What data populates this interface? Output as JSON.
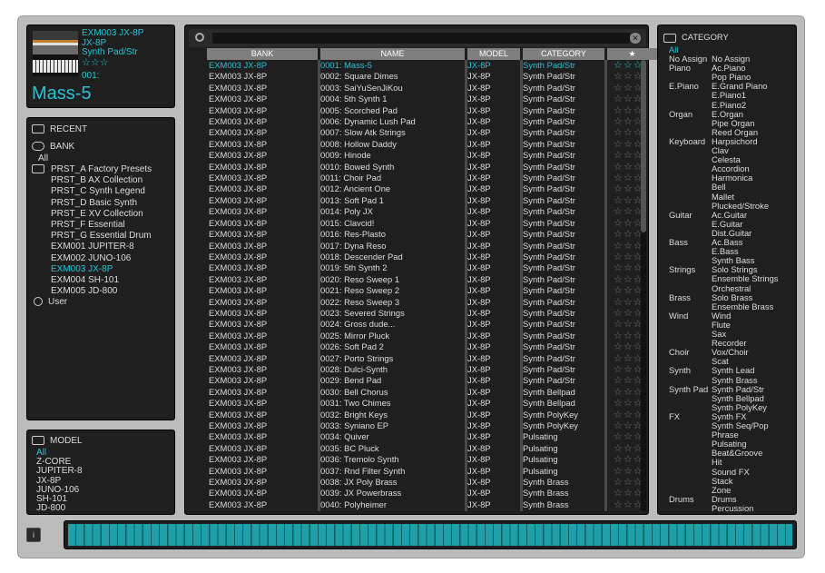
{
  "info": {
    "line1": "EXM003 JX-8P",
    "line2": "JX-8P",
    "line3": "Synth Pad/Str",
    "stars": "☆☆☆",
    "number": "001:",
    "patch": "Mass-5"
  },
  "nav": {
    "recent": "RECENT",
    "bank": "BANK",
    "all": "All",
    "user": "User",
    "banks": [
      "PRST_A Factory Presets",
      "PRST_B AX Collection",
      "PRST_C Synth Legend",
      "PRST_D Basic Synth",
      "PRST_E XV Collection",
      "PRST_F Essential",
      "PRST_G Essential Drum",
      "EXM001 JUPITER-8",
      "EXM002 JUNO-106",
      "EXM003 JX-8P",
      "EXM004 SH-101",
      "EXM005 JD-800"
    ]
  },
  "model": {
    "title": "MODEL",
    "items": [
      "All",
      "Z-CORE",
      "JUPITER-8",
      "JX-8P",
      "JUNO-106",
      "SH-101",
      "JD-800"
    ]
  },
  "list": {
    "headers": [
      "BANK",
      "NAME",
      "MODEL",
      "CATEGORY",
      "★"
    ],
    "rows": [
      [
        "EXM003 JX-8P",
        "0001: Mass-5",
        "JX-8P",
        "Synth Pad/Str"
      ],
      [
        "EXM003 JX-8P",
        "0002: Square Dimes",
        "JX-8P",
        "Synth Pad/Str"
      ],
      [
        "EXM003 JX-8P",
        "0003: SaiYuSenJiKou",
        "JX-8P",
        "Synth Pad/Str"
      ],
      [
        "EXM003 JX-8P",
        "0004: 5th Synth 1",
        "JX-8P",
        "Synth Pad/Str"
      ],
      [
        "EXM003 JX-8P",
        "0005: Scorched Pad",
        "JX-8P",
        "Synth Pad/Str"
      ],
      [
        "EXM003 JX-8P",
        "0006: Dynamic Lush Pad",
        "JX-8P",
        "Synth Pad/Str"
      ],
      [
        "EXM003 JX-8P",
        "0007: Slow Atk Strings",
        "JX-8P",
        "Synth Pad/Str"
      ],
      [
        "EXM003 JX-8P",
        "0008: Hollow Daddy",
        "JX-8P",
        "Synth Pad/Str"
      ],
      [
        "EXM003 JX-8P",
        "0009: Hinode",
        "JX-8P",
        "Synth Pad/Str"
      ],
      [
        "EXM003 JX-8P",
        "0010: Bowed Synth",
        "JX-8P",
        "Synth Pad/Str"
      ],
      [
        "EXM003 JX-8P",
        "0011: Choir Pad",
        "JX-8P",
        "Synth Pad/Str"
      ],
      [
        "EXM003 JX-8P",
        "0012: Ancient One",
        "JX-8P",
        "Synth Pad/Str"
      ],
      [
        "EXM003 JX-8P",
        "0013: Soft Pad 1",
        "JX-8P",
        "Synth Pad/Str"
      ],
      [
        "EXM003 JX-8P",
        "0014: Poly JX",
        "JX-8P",
        "Synth Pad/Str"
      ],
      [
        "EXM003 JX-8P",
        "0015: Clavcid!",
        "JX-8P",
        "Synth Pad/Str"
      ],
      [
        "EXM003 JX-8P",
        "0016: Res-Plasto",
        "JX-8P",
        "Synth Pad/Str"
      ],
      [
        "EXM003 JX-8P",
        "0017: Dyna Reso",
        "JX-8P",
        "Synth Pad/Str"
      ],
      [
        "EXM003 JX-8P",
        "0018: Descender Pad",
        "JX-8P",
        "Synth Pad/Str"
      ],
      [
        "EXM003 JX-8P",
        "0019: 5th Synth 2",
        "JX-8P",
        "Synth Pad/Str"
      ],
      [
        "EXM003 JX-8P",
        "0020: Reso Sweep 1",
        "JX-8P",
        "Synth Pad/Str"
      ],
      [
        "EXM003 JX-8P",
        "0021: Reso Sweep 2",
        "JX-8P",
        "Synth Pad/Str"
      ],
      [
        "EXM003 JX-8P",
        "0022: Reso Sweep 3",
        "JX-8P",
        "Synth Pad/Str"
      ],
      [
        "EXM003 JX-8P",
        "0023: Severed Strings",
        "JX-8P",
        "Synth Pad/Str"
      ],
      [
        "EXM003 JX-8P",
        "0024: Gross dude...",
        "JX-8P",
        "Synth Pad/Str"
      ],
      [
        "EXM003 JX-8P",
        "0025: Mirror Pluck",
        "JX-8P",
        "Synth Pad/Str"
      ],
      [
        "EXM003 JX-8P",
        "0026: Soft Pad 2",
        "JX-8P",
        "Synth Pad/Str"
      ],
      [
        "EXM003 JX-8P",
        "0027: Porto Strings",
        "JX-8P",
        "Synth Pad/Str"
      ],
      [
        "EXM003 JX-8P",
        "0028: Dulci-Synth",
        "JX-8P",
        "Synth Pad/Str"
      ],
      [
        "EXM003 JX-8P",
        "0029: Bend Pad",
        "JX-8P",
        "Synth Pad/Str"
      ],
      [
        "EXM003 JX-8P",
        "0030: Bell Chorus",
        "JX-8P",
        "Synth Bellpad"
      ],
      [
        "EXM003 JX-8P",
        "0031: Two Chimes",
        "JX-8P",
        "Synth Bellpad"
      ],
      [
        "EXM003 JX-8P",
        "0032: Bright Keys",
        "JX-8P",
        "Synth PolyKey"
      ],
      [
        "EXM003 JX-8P",
        "0033: Syniano EP",
        "JX-8P",
        "Synth PolyKey"
      ],
      [
        "EXM003 JX-8P",
        "0034: Quiver",
        "JX-8P",
        "Pulsating"
      ],
      [
        "EXM003 JX-8P",
        "0035: BC Pluck",
        "JX-8P",
        "Pulsating"
      ],
      [
        "EXM003 JX-8P",
        "0036: Tremolo Synth",
        "JX-8P",
        "Pulsating"
      ],
      [
        "EXM003 JX-8P",
        "0037: Rnd Filter Synth",
        "JX-8P",
        "Pulsating"
      ],
      [
        "EXM003 JX-8P",
        "0038: JX Poly Brass",
        "JX-8P",
        "Synth Brass"
      ],
      [
        "EXM003 JX-8P",
        "0039: JX Powerbrass",
        "JX-8P",
        "Synth Brass"
      ],
      [
        "EXM003 JX-8P",
        "0040: Polyheimer",
        "JX-8P",
        "Synth Brass"
      ]
    ]
  },
  "category": {
    "title": "CATEGORY",
    "all": "All",
    "groups": [
      [
        "No Assign",
        [
          "No Assign"
        ]
      ],
      [
        "Piano",
        [
          "Ac.Piano",
          "Pop Piano"
        ]
      ],
      [
        "E.Piano",
        [
          "E.Grand Piano",
          "E.Piano1",
          "E.Piano2"
        ]
      ],
      [
        "Organ",
        [
          "E.Organ",
          "Pipe Organ",
          "Reed Organ"
        ]
      ],
      [
        "Keyboard",
        [
          "Harpsichord",
          "Clav",
          "Celesta",
          "Accordion",
          "Harmonica",
          "Bell",
          "Mallet",
          "Plucked/Stroke"
        ]
      ],
      [
        "Guitar",
        [
          "Ac.Guitar",
          "E.Guitar",
          "Dist.Guitar"
        ]
      ],
      [
        "Bass",
        [
          "Ac.Bass",
          "E.Bass",
          "Synth Bass"
        ]
      ],
      [
        "Strings",
        [
          "Solo Strings",
          "Ensemble Strings",
          "Orchestral"
        ]
      ],
      [
        "Brass",
        [
          "Solo Brass",
          "Ensemble Brass"
        ]
      ],
      [
        "Wind",
        [
          "Wind",
          "Flute",
          "Sax",
          "Recorder"
        ]
      ],
      [
        "Choir",
        [
          "Vox/Choir",
          "Scat"
        ]
      ],
      [
        "Synth",
        [
          "Synth Lead",
          "Synth Brass"
        ]
      ],
      [
        "Synth Pad",
        [
          "Synth Pad/Str",
          "Synth Bellpad",
          "Synth PolyKey"
        ]
      ],
      [
        "FX",
        [
          "Synth FX",
          "Synth Seq/Pop",
          "Phrase",
          "Pulsating",
          "Beat&Groove",
          "Hit",
          "Sound FX",
          "Stack",
          "Zone"
        ]
      ],
      [
        "Drums",
        [
          "Drums",
          "Percussion"
        ]
      ]
    ]
  },
  "keyboard": {
    "info_button": "i"
  }
}
